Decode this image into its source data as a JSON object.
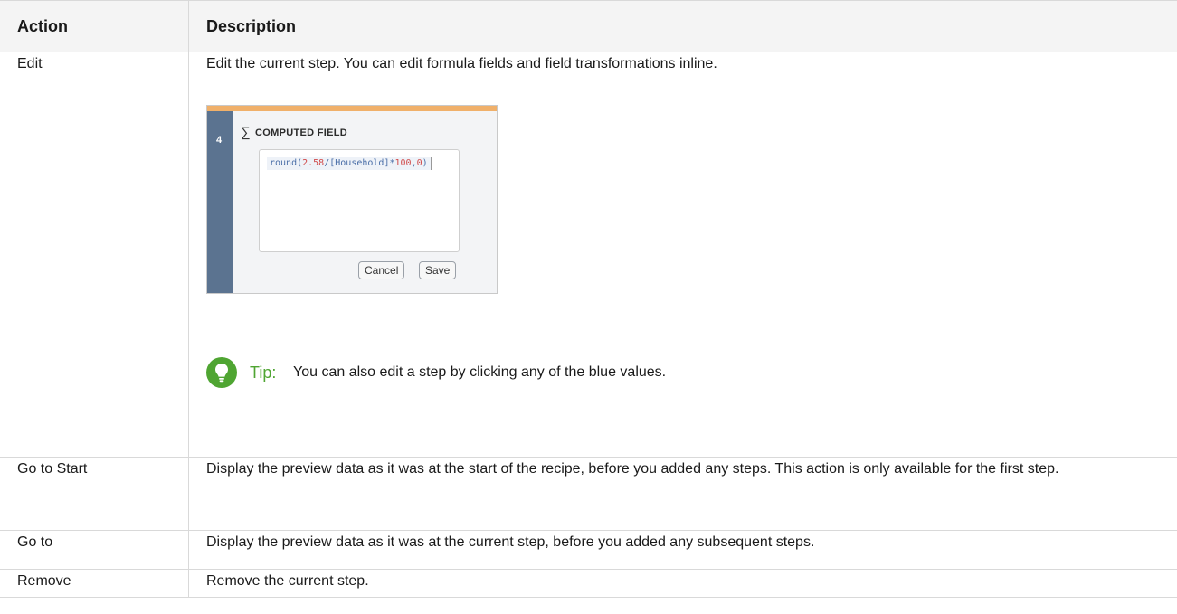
{
  "table": {
    "headers": {
      "action": "Action",
      "description": "Description"
    },
    "rows": [
      {
        "action": "Edit",
        "description": "Edit the current step. You can edit formula fields and field transformations inline."
      },
      {
        "action": "Go to Start",
        "description": "Display the preview data as it was at the start of the recipe, before you added any steps. This action is only available for the first step."
      },
      {
        "action": "Go to",
        "description": "Display the preview data as it was at the current step, before you added any subsequent steps."
      },
      {
        "action": "Remove",
        "description": "Remove the current step."
      }
    ]
  },
  "computed_field_example": {
    "step_number": "4",
    "sigma_symbol": "∑",
    "title": "COMPUTED FIELD",
    "formula_parts": [
      "round(",
      "2.58",
      "/[Household]*",
      "100",
      ",",
      "0",
      ")"
    ],
    "cancel_label": "Cancel",
    "save_label": "Save",
    "accent_color": "#f0b06a",
    "sidebar_color": "#5b7390"
  },
  "tip": {
    "label": "Tip:",
    "text": "You can also edit a step by clicking any of the blue values.",
    "icon": "lightbulb-icon",
    "color": "#4fa532"
  }
}
